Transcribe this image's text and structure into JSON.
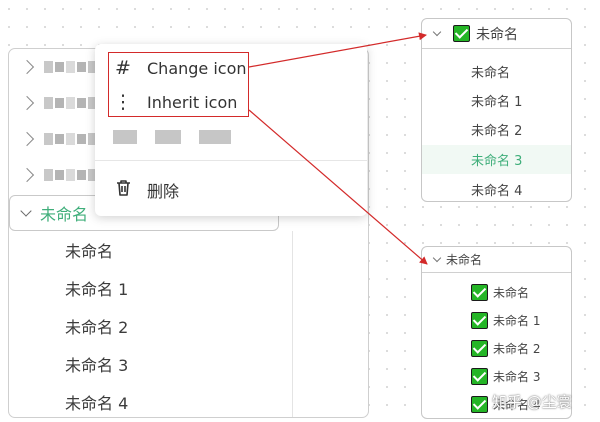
{
  "main_tree": {
    "group_label": "未命名",
    "children": [
      "未命名",
      "未命名 1",
      "未命名 2",
      "未命名 3",
      "未命名 4"
    ]
  },
  "context_menu": {
    "change_icon": {
      "label": "Change icon",
      "icon": "#"
    },
    "inherit_icon": {
      "label": "Inherit icon",
      "icon": "⋮"
    },
    "delete": {
      "label": "删除",
      "icon": "trash-icon"
    }
  },
  "right_panel_top": {
    "title": "未命名",
    "items": [
      "未命名",
      "未命名 1",
      "未命名 2",
      "未命名 3",
      "未命名 4"
    ],
    "selected_index": 3
  },
  "right_panel_bottom": {
    "title": "未命名",
    "items": [
      "未命名",
      "未命名 1",
      "未命名 2",
      "未命名 3",
      "未命名 4"
    ]
  },
  "watermark": "知乎 @尘寰",
  "colors": {
    "accent_green": "#3fae7a",
    "check_green": "#24b526",
    "highlight_red": "#d32a2a"
  }
}
